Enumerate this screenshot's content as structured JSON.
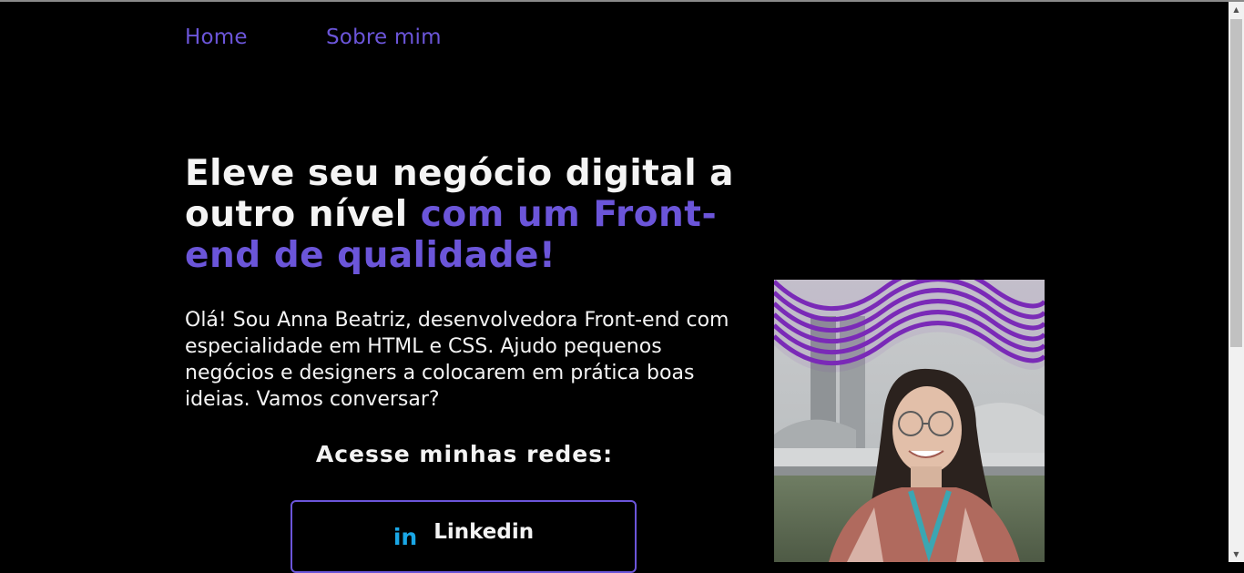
{
  "nav": {
    "items": [
      {
        "label": "Home"
      },
      {
        "label": "Sobre mim"
      }
    ]
  },
  "hero": {
    "title_plain": "Eleve seu negócio digital a outro nível ",
    "title_accent": "com um Front-end de qualidade!",
    "intro": "Olá! Sou Anna Beatriz, desenvolvedora Front-end com especialidade em HTML e CSS. Ajudo pequenos negócios e designers a colocarem em prática boas ideias. Vamos conversar?"
  },
  "networks": {
    "title": "Acesse minhas redes:",
    "buttons": [
      {
        "label": "Linkedin",
        "icon": "linkedin-icon",
        "icon_glyph": "in"
      }
    ]
  },
  "photo": {
    "icon": "profile-photo",
    "description_hidden": ""
  },
  "colors": {
    "accent": "#6b55d9",
    "background": "#000000",
    "text": "#f4f4f4",
    "linkedin": "#1aa7e6",
    "wave": "#7a2bb8"
  }
}
